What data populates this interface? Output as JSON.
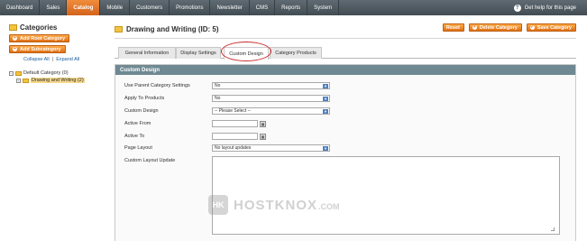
{
  "nav": {
    "items": [
      "Dashboard",
      "Sales",
      "Catalog",
      "Mobile",
      "Customers",
      "Promotions",
      "Newsletter",
      "CMS",
      "Reports",
      "System"
    ],
    "active": "Catalog",
    "help_text": "Get help for this page"
  },
  "sidebar": {
    "title": "Categories",
    "add_root_label": "Add Root Category",
    "add_sub_label": "Add Subcategory",
    "collapse_all": "Collapse All",
    "separator": "|",
    "expand_all": "Expand All",
    "tree": {
      "root": "Default Category (0)",
      "child": "Drawing and Writing (2)"
    }
  },
  "content": {
    "title": "Drawing and Writing (ID: 5)",
    "actions": {
      "reset": "Reset",
      "delete": "Delete Category",
      "save": "Save Category"
    },
    "tabs": [
      "General Information",
      "Display Settings",
      "Custom Design",
      "Category Products"
    ],
    "active_tab": "Custom Design",
    "section_title": "Custom Design",
    "fields": {
      "use_parent": {
        "label": "Use Parent Category Settings",
        "value": "No"
      },
      "apply_to_products": {
        "label": "Apply To Products",
        "value": "No"
      },
      "custom_design": {
        "label": "Custom Design",
        "value": "-- Please Select --"
      },
      "active_from": {
        "label": "Active From",
        "value": ""
      },
      "active_to": {
        "label": "Active To",
        "value": ""
      },
      "page_layout": {
        "label": "Page Layout",
        "value": "No layout updates"
      },
      "custom_layout_update": {
        "label": "Custom Layout Update",
        "value": ""
      }
    }
  },
  "watermark": {
    "logo_text": "HK",
    "brand": "HOSTKNOX",
    "suffix": ".COM"
  },
  "colors": {
    "accent": "#df6f14",
    "section_header": "#6f8992",
    "nav_bg": "#4f5a61"
  }
}
